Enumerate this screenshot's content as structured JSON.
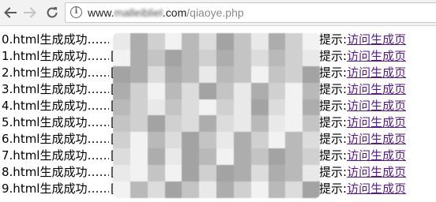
{
  "browser": {
    "url": {
      "host_prefix": "www.",
      "host_blurred": "malleibliel",
      "host_suffix": ".com",
      "path": "/qiaoye.php"
    },
    "icons": [
      "back-arrow-icon",
      "forward-arrow-icon",
      "reload-icon",
      "info-icon"
    ]
  },
  "page": {
    "lines": [
      {
        "prefix": "0.html生成成功……",
        "fragment": "",
        "fragment_top": "\"|",
        "tip_label": "提示:",
        "link": "访问生成页"
      },
      {
        "prefix": "1.html生成成功……",
        "fragment": "[",
        "fragment_top": "",
        "tip_label": "提示:",
        "link": "访问生成页"
      },
      {
        "prefix": "2.html生成成功……",
        "fragment": "[",
        "fragment_top": "",
        "tip_label": "提示:",
        "link": "访问生成页"
      },
      {
        "prefix": "3.html生成成功……",
        "fragment": "[",
        "fragment_top": "",
        "tip_label": "提示:",
        "link": "访问生成页"
      },
      {
        "prefix": "4.html生成成功……",
        "fragment": "[",
        "fragment_top": "",
        "tip_label": "提示:",
        "link": "访问生成页"
      },
      {
        "prefix": "5.html生成成功……",
        "fragment": "[",
        "fragment_top": "",
        "tip_label": "提示:",
        "link": "访问生成页"
      },
      {
        "prefix": "6.html生成成功……",
        "fragment": "[",
        "fragment_top": "",
        "tip_label": "提示:",
        "link": "访问生成页"
      },
      {
        "prefix": "7.html生成成功……",
        "fragment": "[",
        "fragment_top": "",
        "tip_label": "提示:",
        "link": "访问生成页"
      },
      {
        "prefix": "8.html生成成功……",
        "fragment": "[",
        "fragment_top": "",
        "tip_label": "提示:",
        "link": "访问生成页"
      },
      {
        "prefix": "9.html生成成功……",
        "fragment": "[",
        "fragment_top": "",
        "tip_label": "提示:",
        "link": "访问生成页"
      }
    ]
  },
  "colors": {
    "link": "#551a8b",
    "text": "#000000",
    "mosaic_shades": [
      "#e9e9e9",
      "#dcdcdc",
      "#d0d0d0",
      "#c4c4c4",
      "#b9b9b9",
      "#adadad",
      "#a3a3a3",
      "#f2f2f2"
    ]
  }
}
